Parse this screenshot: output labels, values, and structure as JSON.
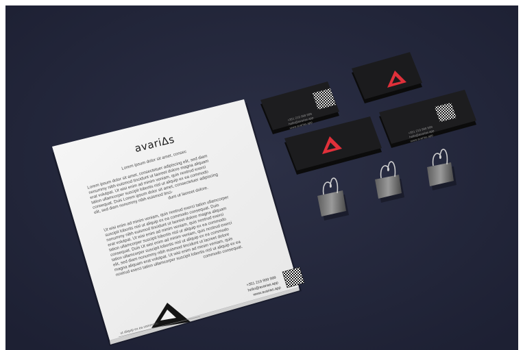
{
  "brand": {
    "logo_text": "avariΔs",
    "accent_color": "#e0303a",
    "background_color": "#23263a"
  },
  "letterhead": {
    "intro": "Lorem ipsum dolor sit amet, consec",
    "paragraph1": [
      "Lorem ipsum dolor sit amet, consectetuer adipiscing elit, sed diam",
      "nonummy nibh euismod tincidunt ut laoreet dolore magna aliquam",
      "erat volutpat. Ut wisi enim ad minim veniam, quis nostrud exerci",
      "tation ullamcorper suscipit lobortis nisl ut aliquip ex ea commodo",
      "consequat. Duis Lorem ipsum dolor sit amet, consectetuer adipiscing",
      "elit, sed diam nonummy nibh euismod tinci-",
      "dunt ut laoreet dolore."
    ],
    "paragraph2": [
      "Ut wisi enim ad minim veniam, quis nostrud exerci tation ullamcorper",
      "suscipit lobortis nisl ut aliquip ex ea commodo consequat. Duis",
      "nonummy nibh euismod tincidunt ut laoreet dolore magna aliquam",
      "erat volutpat. Ut wisi enim ad minim veniam, quis nostrud exerci",
      "tation ullamcorper suscipit lobortis nisl ut aliquip ex ea commodo",
      "consequat. Duis Ut wisi enim ad minim veniam, quis nostrud exerci",
      "tation ullamcorper suscipit lobortis nisl ut aliquip ex ea commodo",
      "elit, sed diam nonummy nibh euismod tincidunt ut laoreet dolore",
      "magna aliquam erat volutpat. Ut wisi enim ad minim veniam, quis",
      "nostrud exerci tation ullamcorper suscipit lobortis nisl ut aliquip ex ea",
      "commodo consequat."
    ],
    "phone": "+351 219 999 999",
    "email": "hello@avarias.app",
    "website": "www.avarias.app",
    "footer": "ut aliquip ex ea commodo"
  },
  "business_card": {
    "lines": [
      "+351 219 999 999",
      "hello@avarias.app",
      "www.avarias.app"
    ]
  }
}
